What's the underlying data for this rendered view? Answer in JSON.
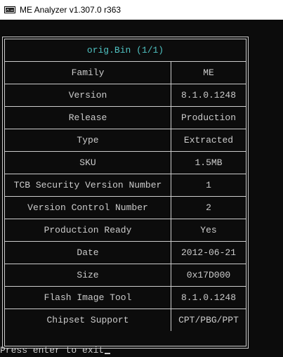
{
  "window": {
    "title": "ME Analyzer v1.307.0 r363",
    "icon": "me-analyzer-app-icon"
  },
  "table": {
    "title": "orig.Bin (1/1)",
    "rows": [
      {
        "label": "Family",
        "value": "ME"
      },
      {
        "label": "Version",
        "value": "8.1.0.1248"
      },
      {
        "label": "Release",
        "value": "Production"
      },
      {
        "label": "Type",
        "value": "Extracted"
      },
      {
        "label": "SKU",
        "value": "1.5MB"
      },
      {
        "label": "TCB Security Version Number",
        "value": "1"
      },
      {
        "label": "Version Control Number",
        "value": "2"
      },
      {
        "label": "Production Ready",
        "value": "Yes"
      },
      {
        "label": "Date",
        "value": "2012-06-21"
      },
      {
        "label": "Size",
        "value": "0x17D000"
      },
      {
        "label": "Flash Image Tool",
        "value": "8.1.0.1248"
      },
      {
        "label": "Chipset Support",
        "value": "CPT/PBG/PPT"
      }
    ]
  },
  "prompt": {
    "text": "Press enter to exit"
  },
  "colors": {
    "background": "#0c0c0c",
    "text": "#cccccc",
    "title_accent": "#4fc1c1",
    "titlebar": "#ffffff"
  }
}
